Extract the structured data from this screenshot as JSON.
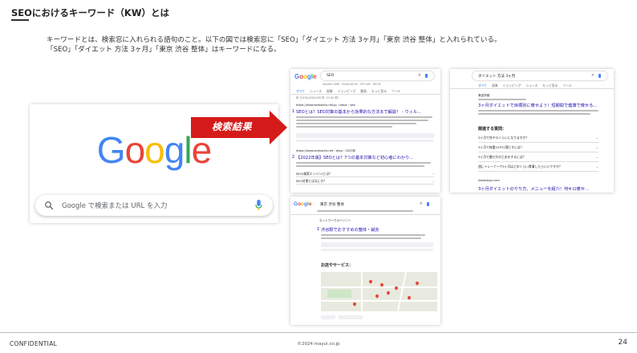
{
  "slide": {
    "title": "SEOにおけるキーワード（KW）とは",
    "intro_line1": "キーワードとは、検索窓に入れられる語句のこと。以下の図では検索窓に「SEO」「ダイエット 方法 3ヶ月」「東京 渋谷 整体」と入れられている。",
    "intro_line2": "「SEO」「ダイエット 方法 3ヶ月」「東京 渋谷 整体」はキーワードになる。"
  },
  "google_home": {
    "logo_letters": [
      {
        "char": "G",
        "color": "#4285F4"
      },
      {
        "char": "o",
        "color": "#EA4335"
      },
      {
        "char": "o",
        "color": "#FBBC05"
      },
      {
        "char": "g",
        "color": "#4285F4"
      },
      {
        "char": "l",
        "color": "#34A853"
      },
      {
        "char": "e",
        "color": "#EA4335"
      }
    ],
    "search_placeholder": "Google で検索または URL を入力",
    "search_icon": "search-icon",
    "mic_icon": "microphone-icon"
  },
  "arrow": {
    "label": "検索結果",
    "color": "#D51A1A"
  },
  "serp_seo": {
    "logo": "Google",
    "query": "SEO",
    "tabs": [
      "すべて",
      "ニュース",
      "画像",
      "ショッピング",
      "動画",
      "もっと見る",
      "ツール"
    ],
    "result_count": "約 3,930,000,000 件（0.42 秒）",
    "result1_url": "https://www.seohacks.net.jp › basic › seo",
    "result1_title": "SEOとは？SEO対策の基本から効果的な方法まで解説！ - ウィル...",
    "result2_url": "https://www.seohacks.net › blog › 2023年",
    "result2_title": "【2022年版】SEOとは？7つの基本対策など初心者にわかり...",
    "rank1": "1",
    "rank2": "2",
    "sub1": "SEO(検索エンジン)とは？",
    "sub2": "SEO対策とはなにか？"
  },
  "serp_diet": {
    "query": "ダイエット 方法 3ヶ月",
    "tabs": [
      "すべて",
      "画像",
      "ショッピング",
      "ニュース",
      "もっと見る",
      "ツール"
    ],
    "site": "美容学館",
    "result_title": "3ヶ月ダイエットで目標別に痩せよう！短期間で健康で痩せる...",
    "paa_title": "関連する質問：",
    "paa": [
      "3ヶ月で何キロくらいになりますか？",
      "3ヶ月で体重10キロ落とすには？",
      "3ヶ月で痩せ方の工夫をするには？",
      "週にトレーナーで3ヶ月はどのくらい食事したらいいですか？"
    ],
    "result2_site": "liskdesign.com",
    "result2_title": "3ヶ月ダイエットのやり方、メニューを紹介！何キロ痩せ..."
  },
  "serp_seitai": {
    "logo": "Google",
    "query": "東京 渋谷 整体",
    "site": "ネットワークカーソニー",
    "result_title": "渋谷駅でおすすめの整体・鍼灸",
    "rank": "1",
    "map_heading": "お店やサービス："
  },
  "footer": {
    "confidential": "CONFIDENTIAL",
    "copyright": "©2024 mayui.co.jp",
    "page": "24"
  }
}
